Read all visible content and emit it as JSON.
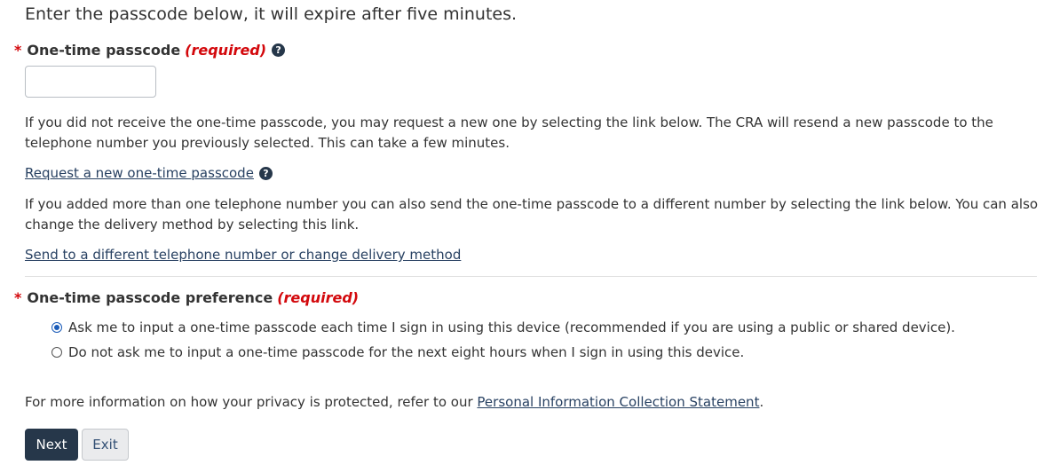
{
  "intro": "Enter the passcode below, it will expire after five minutes.",
  "passcode_field": {
    "required_marker": "*",
    "label": "One-time passcode",
    "required_text": "(required)",
    "help_icon": "question-circle-icon",
    "value": "",
    "placeholder": ""
  },
  "resend_paragraph": "If you did not receive the one-time passcode, you may request a new one by selecting the link below. The CRA will resend a new passcode to the telephone number you previously selected. This can take a few minutes.",
  "request_link": "Request a new one-time passcode",
  "different_number_paragraph": "If you added more than one telephone number you can also send the one-time passcode to a different number by selecting the link below. You can also change the delivery method by selecting this link.",
  "different_number_link": "Send to a different telephone number or change delivery method",
  "preference_field": {
    "required_marker": "*",
    "label": "One-time passcode preference",
    "required_text": "(required)",
    "options": [
      {
        "label": "Ask me to input a one-time passcode each time I sign in using this device (recommended if you are using a public or shared device).",
        "selected": true
      },
      {
        "label": "Do not ask me to input a one-time passcode for the next eight hours when I sign in using this device.",
        "selected": false
      }
    ]
  },
  "privacy": {
    "text_before": "For more information on how your privacy is protected, refer to our ",
    "link": "Personal Information Collection Statement",
    "text_after": "."
  },
  "buttons": {
    "next": "Next",
    "exit": "Exit"
  },
  "colors": {
    "required_red": "#d3080c",
    "primary_button": "#26374a",
    "link": "#284162",
    "radio_selected": "#1a5bb8"
  }
}
